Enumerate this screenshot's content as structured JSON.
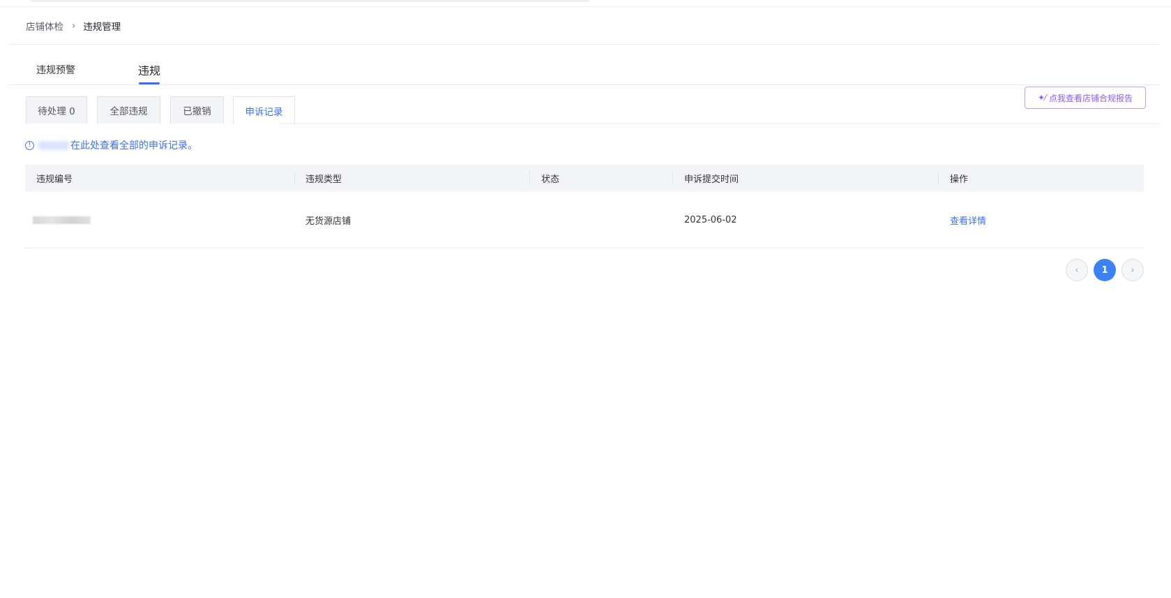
{
  "breadcrumb": {
    "parent": "店铺体检",
    "separator": "›",
    "current": "违规管理"
  },
  "main_tabs": [
    {
      "label": "违规预警",
      "active": false
    },
    {
      "label": "违规",
      "active": true
    }
  ],
  "sub_tabs": [
    {
      "label": "待处理 0",
      "active": false
    },
    {
      "label": "全部违规",
      "active": false
    },
    {
      "label": "已撤销",
      "active": false
    },
    {
      "label": "申诉记录",
      "active": true
    }
  ],
  "report_button": {
    "icon": "sparkle-icon",
    "label": "点我查看店铺合规报告"
  },
  "notice": {
    "icon": "info-icon",
    "text": "在此处查看全部的申诉记录。"
  },
  "table": {
    "columns": [
      "违规编号",
      "违规类型",
      "状态",
      "申诉提交时间",
      "操作"
    ],
    "rows": [
      {
        "id": "",
        "type": "无货源店铺",
        "status": "",
        "submitted": "2025-06-02",
        "action": "查看详情"
      }
    ]
  },
  "pagination": {
    "prev": "‹",
    "current": "1",
    "next": "›"
  },
  "colors": {
    "accent": "#3b6ef5",
    "page_active": "#3b82f6",
    "report_border": "#c99cf0"
  }
}
